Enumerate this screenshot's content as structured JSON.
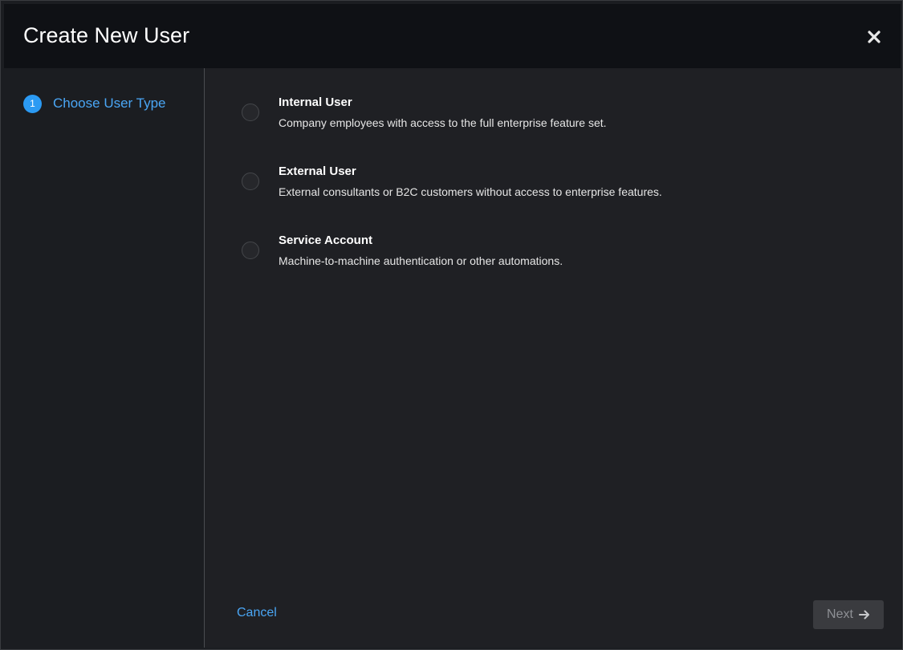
{
  "dialog": {
    "title": "Create New User",
    "close_icon": "close-icon"
  },
  "wizard": {
    "steps": [
      {
        "number": "1",
        "label": "Choose User Type",
        "active": true
      }
    ]
  },
  "user_types": [
    {
      "title": "Internal User",
      "description": "Company employees with access to the full enterprise feature set.",
      "selected": false
    },
    {
      "title": "External User",
      "description": "External consultants or B2C customers without access to enterprise features.",
      "selected": false
    },
    {
      "title": "Service Account",
      "description": "Machine-to-machine authentication or other automations.",
      "selected": false
    }
  ],
  "footer": {
    "cancel_label": "Cancel",
    "next_label": "Next",
    "next_icon": "arrow-right-icon",
    "next_disabled": true
  },
  "colors": {
    "accent": "#2b9af3",
    "link": "#4aa6f5",
    "header_bg": "#0f1115",
    "body_bg": "#1f2024"
  }
}
